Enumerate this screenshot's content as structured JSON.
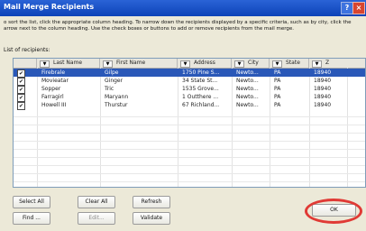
{
  "window": {
    "title": "Mail Merge Recipients",
    "help_label": "?",
    "close_label": "×"
  },
  "instructions": "o sort the list, click the appropriate column heading. To narrow down the recipients displayed by a specific criteria, such as by city, click the arrow next to the column heading. Use the check boxes or buttons to add or remove recipients from the mail merge.",
  "list_label": "List of recipients:",
  "columns": [
    "Last Name",
    "First Name",
    "Address",
    "City",
    "State",
    "Z"
  ],
  "rows": [
    {
      "checked": true,
      "selected": true,
      "last": "Firebrale",
      "first": "Gilpe",
      "address": "1750 Pine S...",
      "city": "Newto...",
      "state": "PA",
      "zip": "18940"
    },
    {
      "checked": true,
      "selected": false,
      "last": "Movieatar",
      "first": "Ginger",
      "address": "34 State St...",
      "city": "Newto...",
      "state": "PA",
      "zip": "18940"
    },
    {
      "checked": true,
      "selected": false,
      "last": "Sopper",
      "first": "Tric",
      "address": "1535 Grove...",
      "city": "Newto...",
      "state": "PA",
      "zip": "18940"
    },
    {
      "checked": true,
      "selected": false,
      "last": "Farragirl",
      "first": "Maryann",
      "address": "1 Outthere ...",
      "city": "Newto...",
      "state": "PA",
      "zip": "18940"
    },
    {
      "checked": true,
      "selected": false,
      "last": "Howell III",
      "first": "Thurstur",
      "address": "67 Richland...",
      "city": "Newto...",
      "state": "PA",
      "zip": "18940"
    }
  ],
  "buttons": {
    "select_all": "Select All",
    "clear_all": "Clear All",
    "refresh": "Refresh",
    "find": "Find ...",
    "edit": "Edit...",
    "validate": "Validate",
    "ok": "OK"
  },
  "colors": {
    "title_bar": "#0d43b8",
    "selection": "#2a58b8",
    "highlight_ring": "#e03a35"
  }
}
